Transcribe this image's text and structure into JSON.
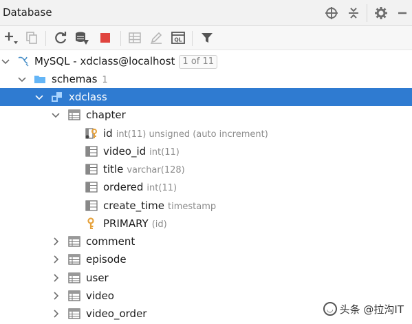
{
  "panel": {
    "title": "Database"
  },
  "colors": {
    "selection": "#2f7bd1",
    "folder": "#64b5f6",
    "key": "#e6a23c",
    "stop": "#e0443e"
  },
  "title_icons": [
    "crosshair-icon",
    "collapse-icon",
    "gear-icon",
    "minimize-icon"
  ],
  "toolbar_icons": [
    "add-icon",
    "duplicate-icon",
    "refresh-icon",
    "schema-sync-icon",
    "stop-icon",
    "table-icon",
    "edit-icon",
    "console-icon",
    "filter-icon"
  ],
  "tree": {
    "datasource": {
      "label": "MySQL - xdclass@localhost",
      "badge": "1 of 11"
    },
    "schemas": {
      "label": "schemas",
      "count": "1"
    },
    "schema": {
      "label": "xdclass"
    },
    "table_open": {
      "label": "chapter"
    },
    "columns": [
      {
        "name": "id",
        "type": "int(11) unsigned (auto increment)"
      },
      {
        "name": "video_id",
        "type": "int(11)"
      },
      {
        "name": "title",
        "type": "varchar(128)"
      },
      {
        "name": "ordered",
        "type": "int(11)"
      },
      {
        "name": "create_time",
        "type": "timestamp"
      }
    ],
    "index": {
      "name": "PRIMARY",
      "cols": "(id)"
    },
    "tables": [
      "comment",
      "episode",
      "user",
      "video",
      "video_order"
    ]
  },
  "watermark": {
    "text": "头条 @拉沟IT"
  }
}
